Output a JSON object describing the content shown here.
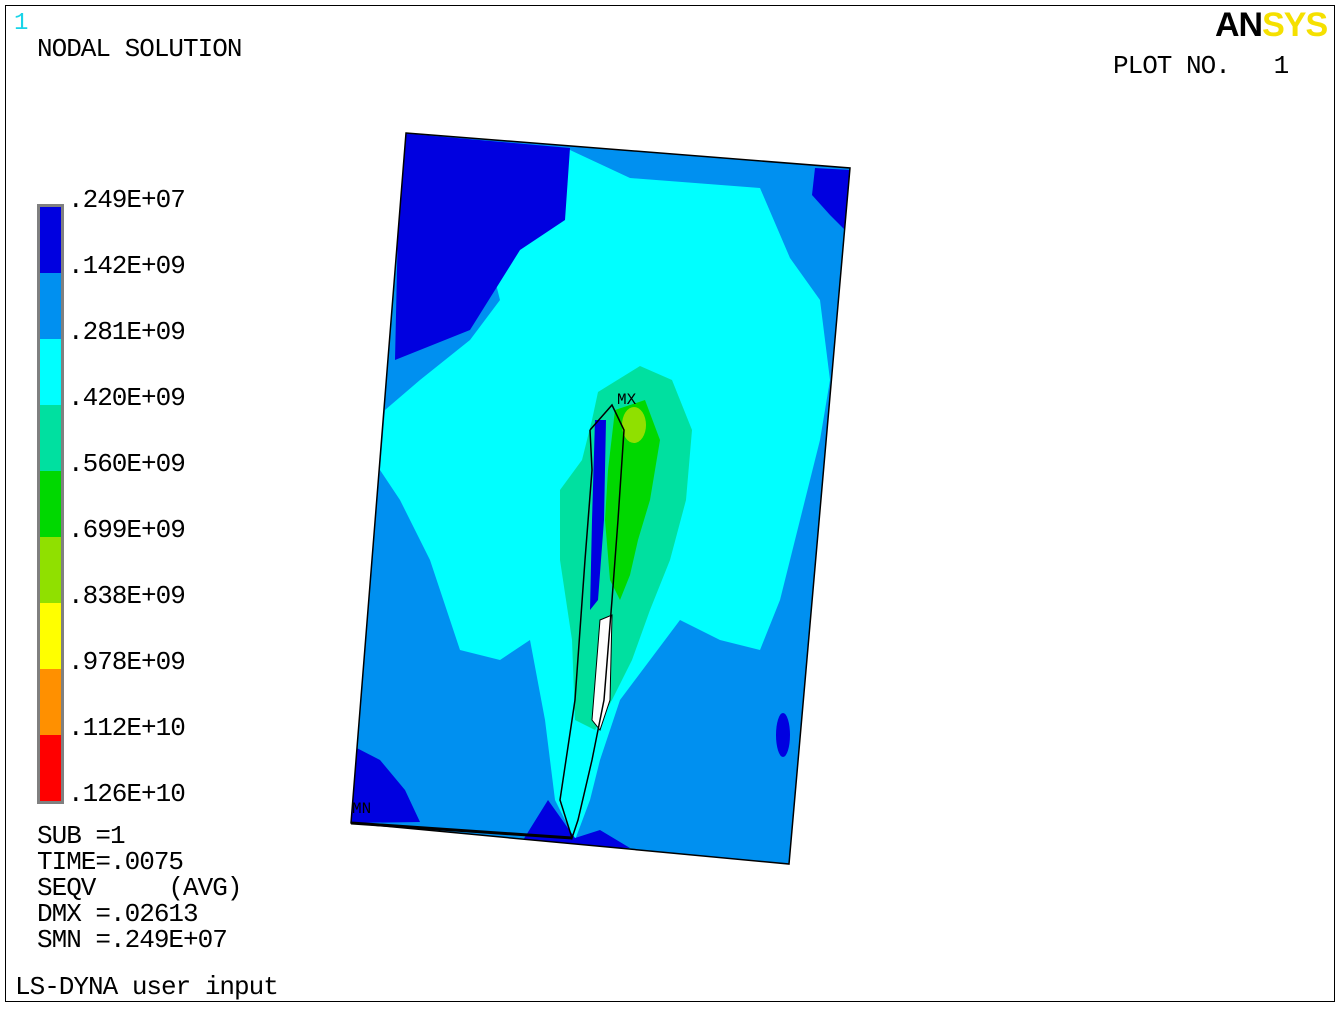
{
  "window_number": "1",
  "title": "NODAL SOLUTION",
  "brand": {
    "part1": "AN",
    "part2": "SYS",
    "colors": {
      "part1": "#000000",
      "part2": "#f5e000"
    }
  },
  "plot_label": "PLOT NO.   1",
  "legend": {
    "labels": [
      ".249E+07",
      ".142E+09",
      ".281E+09",
      ".420E+09",
      ".560E+09",
      ".699E+09",
      ".838E+09",
      ".978E+09",
      ".112E+10",
      ".126E+10"
    ],
    "colors": [
      "#0000e0",
      "#0090f0",
      "#00ffff",
      "#00e0a0",
      "#00d800",
      "#90e000",
      "#ffff00",
      "#ff9000",
      "#ff0000"
    ]
  },
  "info": {
    "sub": "SUB =1",
    "time": "TIME=.0075",
    "seqv": "SEQV     (AVG)",
    "dmx": "DMX =.02613",
    "smn": "SMN =.249E+07"
  },
  "markers": {
    "max": "MX",
    "min": "MN"
  },
  "footer": "LS-DYNA user input"
}
